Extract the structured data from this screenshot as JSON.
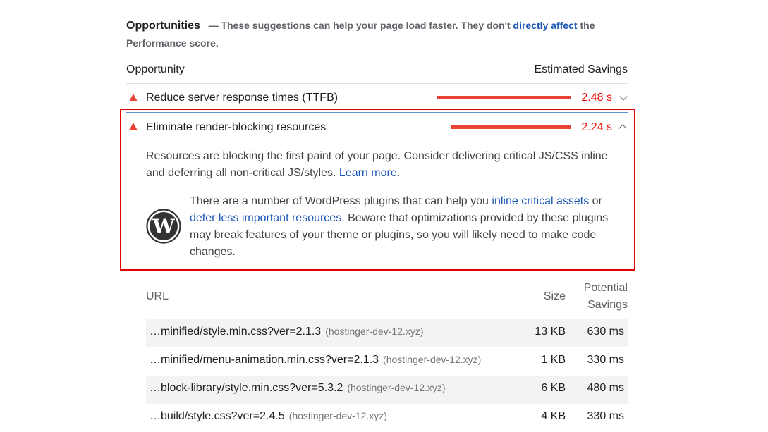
{
  "header": {
    "title": "Opportunities",
    "desc_before": "— These suggestions can help your page load faster. They don't ",
    "desc_link": "directly affect",
    "desc_after": " the Performance score."
  },
  "columns": {
    "opportunity": "Opportunity",
    "estimated_savings": "Estimated Savings"
  },
  "audits": [
    {
      "title": "Reduce server response times (TTFB)",
      "value": "2.48 s",
      "savings_fraction": 1.0,
      "expanded": false
    },
    {
      "title": "Eliminate render-blocking resources",
      "value": "2.24 s",
      "savings_fraction": 0.9,
      "expanded": true
    }
  ],
  "details": {
    "text1": "Resources are blocking the first paint of your page. Consider delivering critical JS/CSS inline and deferring all non-critical JS/styles. ",
    "learn_more": "Learn more",
    "text1_end": ".",
    "wp_text_1": "There are a number of WordPress plugins that can help you ",
    "wp_link_1": "inline critical assets",
    "wp_text_2": " or ",
    "wp_link_2": "defer less important resources",
    "wp_text_3": ". Beware that optimizations provided by these plugins may break features of your theme or plugins, so you will likely need to make code changes.",
    "wp_icon": "wordpress-logo"
  },
  "table": {
    "headers": {
      "url": "URL",
      "size": "Size",
      "savings_line1": "Potential",
      "savings_line2": "Savings"
    },
    "rows": [
      {
        "url": "…minified/style.min.css?ver=2.1.3",
        "host": "(hostinger-dev-12.xyz)",
        "size": "13 KB",
        "savings": "630 ms"
      },
      {
        "url": "…minified/menu-animation.min.css?ver=2.1.3",
        "host": "(hostinger-dev-12.xyz)",
        "size": "1 KB",
        "savings": "330 ms"
      },
      {
        "url": "…block-library/style.min.css?ver=5.3.2",
        "host": "(hostinger-dev-12.xyz)",
        "size": "6 KB",
        "savings": "480 ms"
      },
      {
        "url": "…build/style.css?ver=2.4.5",
        "host": "(hostinger-dev-12.xyz)",
        "size": "4 KB",
        "savings": "330 ms"
      }
    ]
  },
  "colors": {
    "fail": "#eb4236",
    "fail_text": "#eb0f00",
    "link": "#1a56b6",
    "highlight_box": "#e60000"
  }
}
